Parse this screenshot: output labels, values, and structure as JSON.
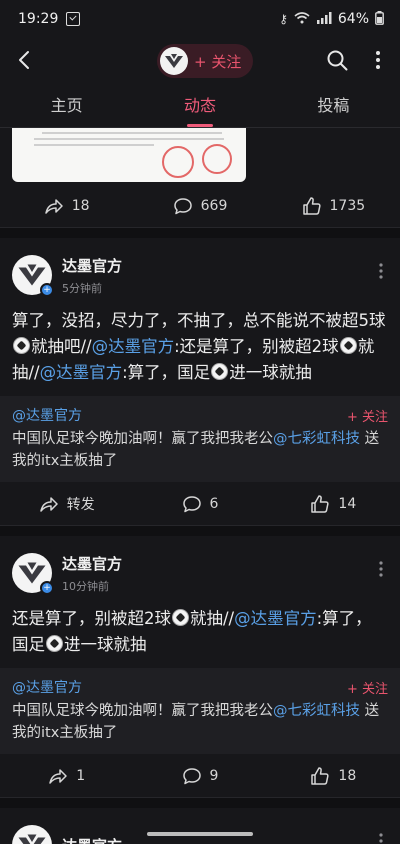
{
  "status": {
    "time": "19:29",
    "battery": "64%"
  },
  "header": {
    "follow_label": "+ 关注"
  },
  "tabs": [
    {
      "label": "主页"
    },
    {
      "label": "动态"
    },
    {
      "label": "投稿"
    }
  ],
  "top_post": {
    "repost_count": "18",
    "comment_count": "669",
    "like_count": "1735"
  },
  "posts": [
    {
      "author": "达墨官方",
      "time": "5分钟前",
      "text_parts": [
        "算了，没招，尽力了，不抽了，总不能说不被超5球",
        "就抽吧//",
        "@达墨官方",
        ":还是算了，别被超2球",
        "就抽//",
        "@达墨官方",
        ":算了，国足",
        "进一球就抽"
      ],
      "quote_user": "@达墨官方",
      "quote_follow": "+ 关注",
      "quote_text_a": "中国队足球今晚加油啊！赢了我把我老公",
      "quote_mention": "@七彩虹科技",
      "quote_text_b": " 送我的itx主板抽了",
      "repost_label": "转发",
      "comment_count": "6",
      "like_count": "14"
    },
    {
      "author": "达墨官方",
      "time": "10分钟前",
      "text_parts": [
        "还是算了，别被超2球",
        "就抽//",
        "@达墨官方",
        ":算了，国足",
        "进一球就抽"
      ],
      "quote_user": "@达墨官方",
      "quote_follow": "+ 关注",
      "quote_text_a": "中国队足球今晚加油啊！赢了我把我老公",
      "quote_mention": "@七彩虹科技",
      "quote_text_b": " 送我的itx主板抽了",
      "repost_count": "1",
      "comment_count": "9",
      "like_count": "18"
    },
    {
      "author": "达墨官方"
    }
  ]
}
